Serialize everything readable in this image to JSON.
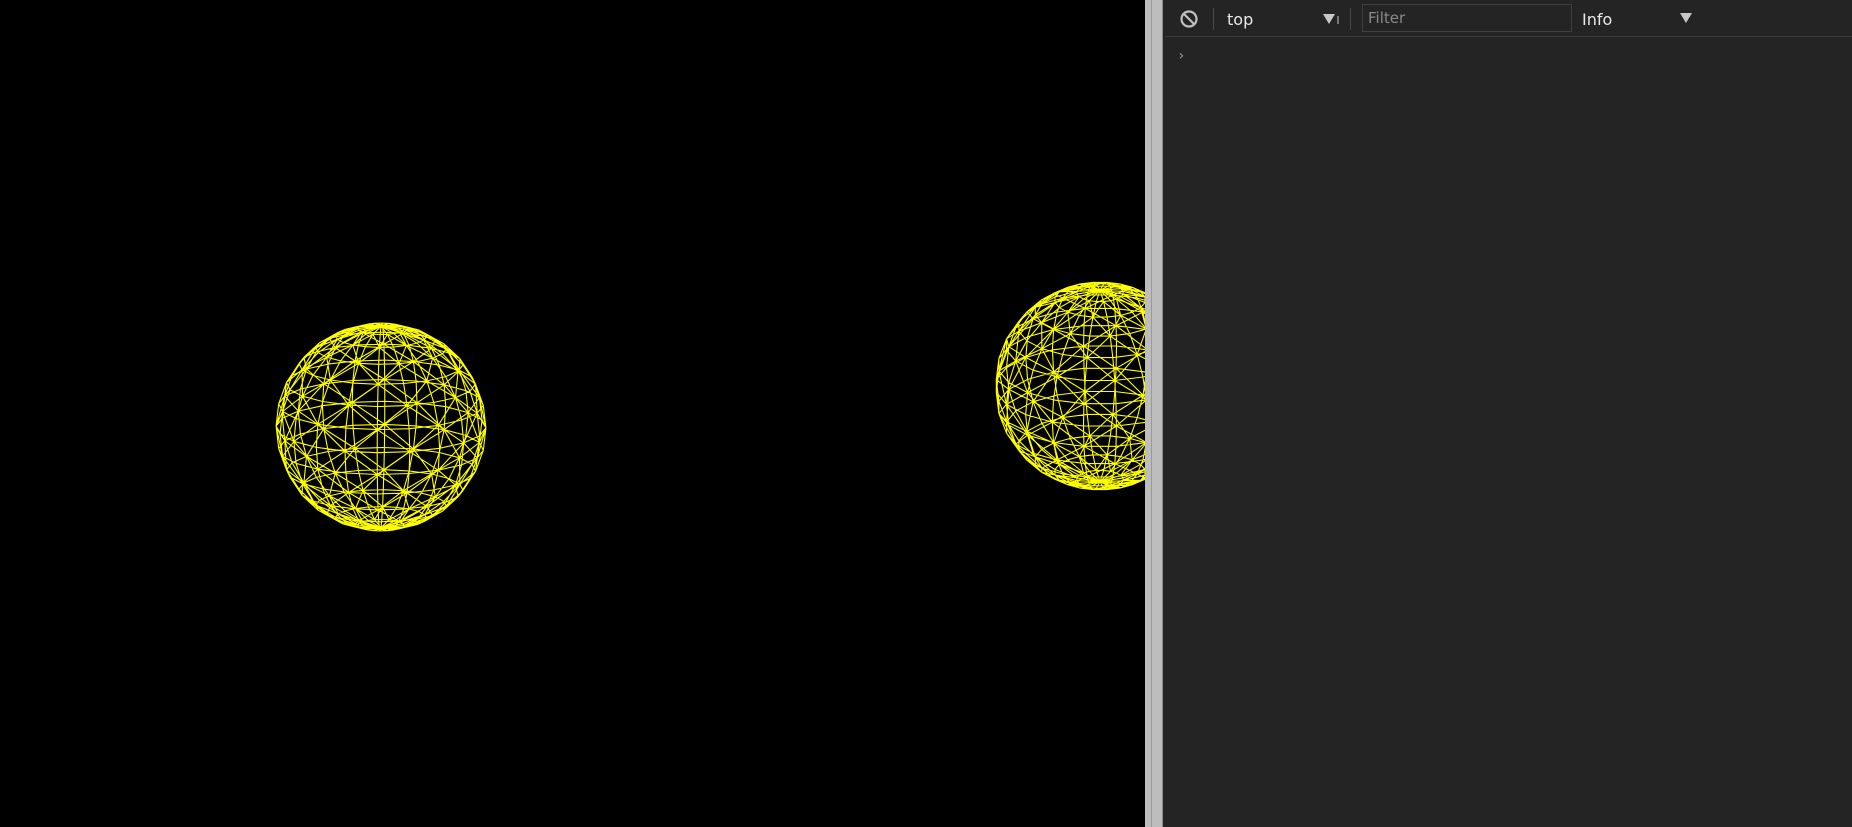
{
  "viewport": {
    "background": "#000000",
    "wireframe_color": "#ffff00",
    "objects": [
      "wireframe-sphere",
      "wireframe-sphere"
    ]
  },
  "console": {
    "background": "#242424",
    "toolbar": {
      "clear_icon": "block-icon",
      "context": "top",
      "filter_placeholder": "Filter",
      "filter_value": "",
      "level": "Info"
    },
    "prompt_icon": "chevron-right-icon",
    "prompt_symbol": "›"
  }
}
